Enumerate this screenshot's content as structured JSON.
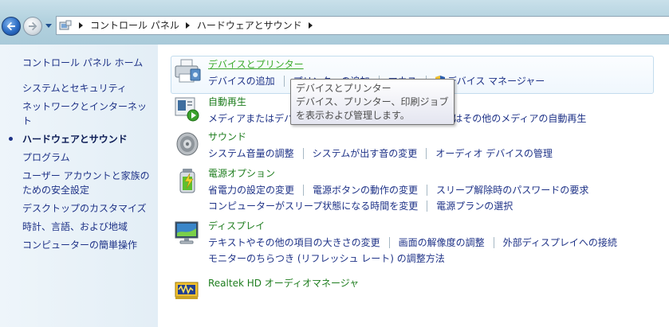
{
  "breadcrumb": {
    "items": [
      "コントロール パネル",
      "ハードウェアとサウンド"
    ]
  },
  "sidebar": {
    "home": "コントロール パネル ホーム",
    "items": [
      {
        "label": "システムとセキュリティ"
      },
      {
        "label": "ネットワークとインターネット"
      },
      {
        "label": "ハードウェアとサウンド",
        "active": true
      },
      {
        "label": "プログラム"
      },
      {
        "label": "ユーザー アカウントと家族のための安全設定"
      },
      {
        "label": "デスクトップのカスタマイズ"
      },
      {
        "label": "時計、言語、および地域"
      },
      {
        "label": "コンピューターの簡単操作"
      }
    ]
  },
  "sections": [
    {
      "title": "デバイスとプリンター",
      "icon": "printer-icon",
      "rows": [
        [
          "デバイスの追加",
          "プリンターの追加",
          "マウス",
          "デバイス マネージャー"
        ]
      ]
    },
    {
      "title": "自動再生",
      "icon": "autoplay-icon",
      "rows": [
        [
          "メディアまたはデバイスの既定の設定の変更",
          "CD またはその他のメディアの自動再生"
        ]
      ]
    },
    {
      "title": "サウンド",
      "icon": "speaker-icon",
      "rows": [
        [
          "システム音量の調整",
          "システムが出す音の変更",
          "オーディオ デバイスの管理"
        ]
      ]
    },
    {
      "title": "電源オプション",
      "icon": "battery-icon",
      "rows": [
        [
          "省電力の設定の変更",
          "電源ボタンの動作の変更",
          "スリープ解除時のパスワードの要求"
        ],
        [
          "コンピューターがスリープ状態になる時間を変更",
          "電源プランの選択"
        ]
      ]
    },
    {
      "title": "ディスプレイ",
      "icon": "monitor-icon",
      "rows": [
        [
          "テキストやその他の項目の大きさの変更",
          "画面の解像度の調整",
          "外部ディスプレイへの接続"
        ],
        [
          "モニターのちらつき (リフレッシュ レート) の調整方法"
        ]
      ]
    },
    {
      "title": "Realtek HD オーディオマネージャ",
      "icon": "audio-manager-icon",
      "rows": []
    }
  ],
  "tooltip": {
    "lines": [
      "デバイスとプリンター",
      "デバイス、プリンター、印刷ジョブ",
      "を表示および管理します。"
    ]
  },
  "colors": {
    "section_title": "#1e7d1e",
    "link": "#1e3287",
    "hover_title": "#3aaa2a"
  }
}
